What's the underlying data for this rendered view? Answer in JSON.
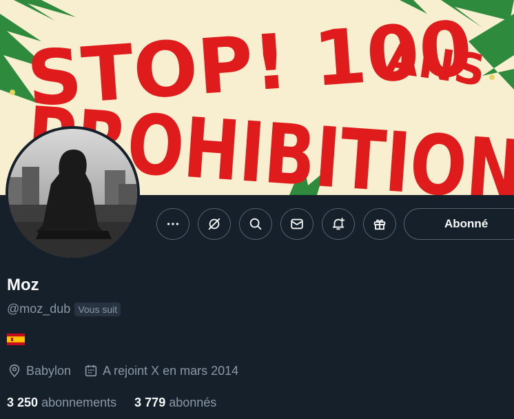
{
  "banner": {
    "line1": "STOP! 100",
    "line1_suffix": "ANS",
    "line2": "PROHIBITION",
    "text_color": "#e01b1b",
    "bg_color": "#f8eed0"
  },
  "profile": {
    "display_name": "Moz",
    "handle": "@moz_dub",
    "follows_you_badge": "Vous suit",
    "flag": "spain-flag"
  },
  "actions": {
    "more_icon": "more-icon",
    "grok_icon": "grok-icon",
    "search_icon": "search-icon",
    "message_icon": "message-icon",
    "notify_icon": "bell-plus-icon",
    "gift_icon": "gift-icon",
    "follow_label": "Abonné"
  },
  "meta": {
    "location": "Babylon",
    "joined": "A rejoint X en mars 2014"
  },
  "stats": {
    "following_count": "3 250",
    "following_label": "abonnements",
    "followers_count": "3 779",
    "followers_label": "abonnés"
  },
  "colors": {
    "background": "#15202b",
    "secondary_text": "#8b98a5",
    "border": "#536471"
  }
}
